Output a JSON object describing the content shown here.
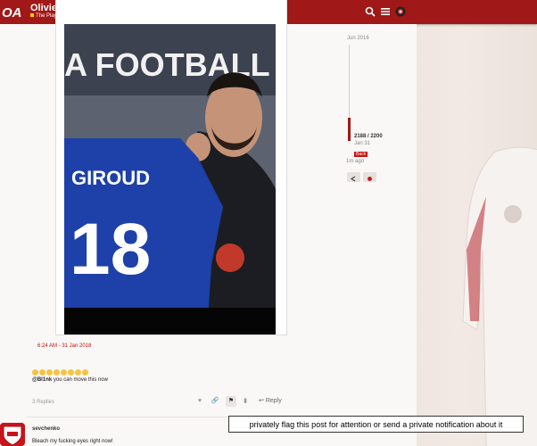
{
  "header": {
    "title": "Olivier Giroud",
    "category": "The Players",
    "icons": [
      "search-icon",
      "menu-icon",
      "user-avatar"
    ]
  },
  "post": {
    "timestamp": "6:24 AM - 31 Jan 2018",
    "mention_user": "@Bl1nk",
    "mention_text": " you can move this now",
    "replies_label": "3 Replies",
    "reply_label": "Reply",
    "photo": {
      "banner_text": "A FOOTBALL",
      "shirt_name": "GIROUD",
      "shirt_number": "18"
    }
  },
  "timeline": {
    "top_date": "Jun 2016",
    "count": "2188 / 2200",
    "date": "Jan 31",
    "back_label": "Back",
    "ago": "1m ago"
  },
  "next_post": {
    "username": "sevchenko",
    "body": "Bleach my fucking eyes right now!"
  },
  "tooltip": {
    "text": "privately flag this post for attention or send a private notification about it"
  },
  "colors": {
    "brand": "#a01817",
    "shirt_blue": "#1d41a8"
  }
}
